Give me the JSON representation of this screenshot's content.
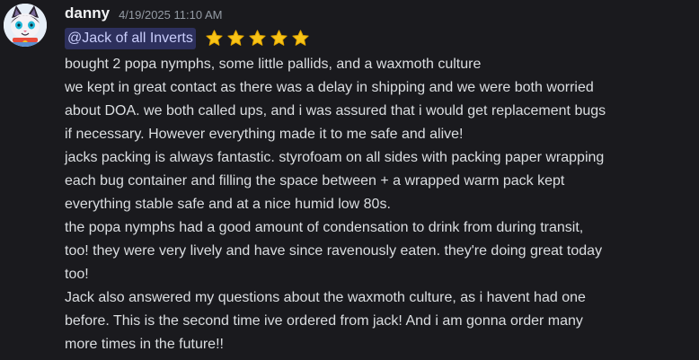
{
  "message": {
    "author": "danny",
    "timestamp": "4/19/2025 11:10 AM",
    "mention": "@Jack of all Inverts",
    "rating_stars": 5,
    "star_icon": "star-emoji",
    "star_color": "#f8c417",
    "mention_bg": "#3a3f72",
    "lines": [
      "bought 2 popa nymphs, some little pallids, and a waxmoth culture",
      "we kept in great contact as there was a delay in shipping and we were both worried",
      "about DOA. we both called ups, and i was assured that i would get replacement bugs",
      "if necessary. However everything made it to me safe and alive!",
      "jacks packing is always fantastic. styrofoam on all sides with packing paper wrapping",
      "each bug container and filling the space between + a wrapped warm pack  kept",
      "everything stable safe and at a nice humid low 80s.",
      "the popa nymphs had a good amount of condensation to drink from during transit,",
      "too! they were very lively and have since ravenously eaten. they're doing great today",
      "too!",
      "Jack also answered my questions about the waxmoth culture, as i havent had one",
      "before. This is the second time ive ordered from jack! And i am gonna order many",
      "more times in the future!!"
    ]
  }
}
